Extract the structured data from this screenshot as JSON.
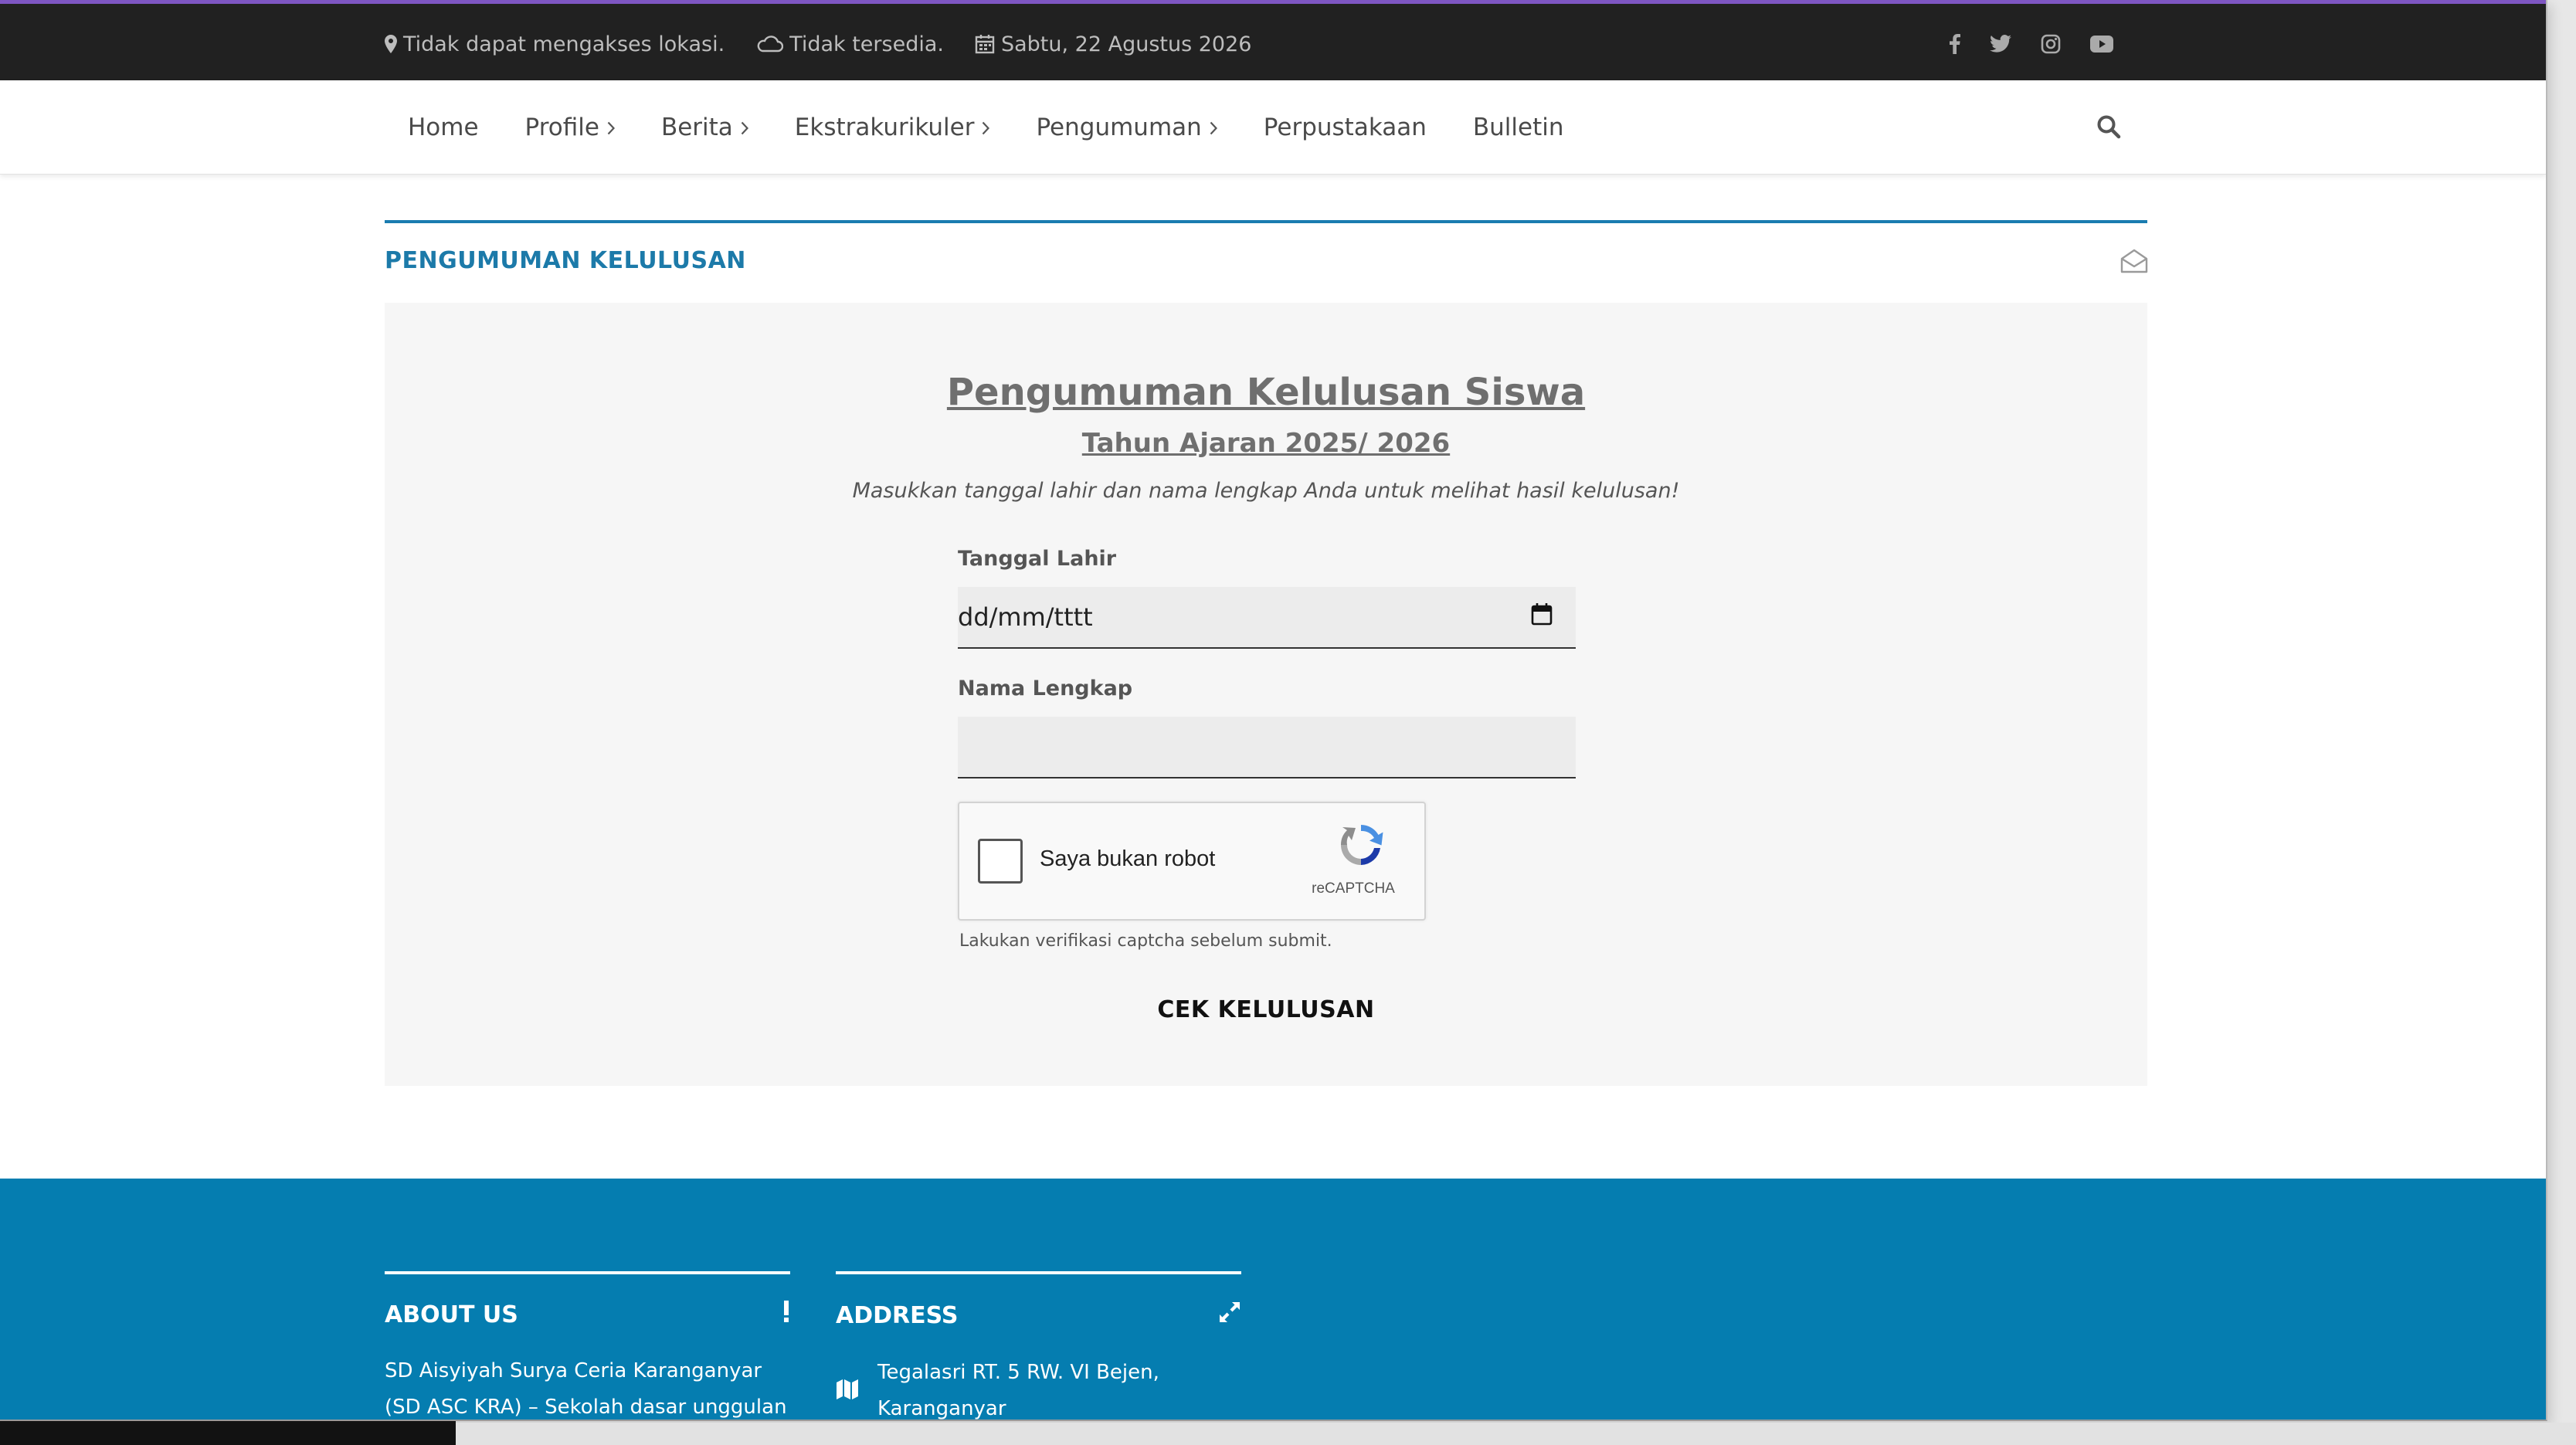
{
  "topbar": {
    "location": "Tidak dapat mengakses lokasi.",
    "weather": "Tidak tersedia.",
    "date": "Sabtu, 22 Agustus 2026",
    "socials": [
      "facebook-icon",
      "twitter-icon",
      "instagram-icon",
      "youtube-icon"
    ]
  },
  "nav": {
    "items": [
      {
        "label": "Home",
        "has_submenu": false
      },
      {
        "label": "Profile",
        "has_submenu": true
      },
      {
        "label": "Berita",
        "has_submenu": true
      },
      {
        "label": "Ekstrakurikuler",
        "has_submenu": true
      },
      {
        "label": "Pengumuman",
        "has_submenu": true
      },
      {
        "label": "Perpustakaan",
        "has_submenu": false
      },
      {
        "label": "Bulletin",
        "has_submenu": false
      }
    ]
  },
  "section": {
    "title": "PENGUMUMAN KELULUSAN"
  },
  "form": {
    "title": "Pengumuman Kelulusan Siswa",
    "subtitle": "Tahun Ajaran 2025/ 2026",
    "instruction": "Masukkan tanggal lahir dan nama lengkap Anda untuk melihat hasil kelulusan!",
    "birthdate_label": "Tanggal Lahir",
    "birthdate_placeholder": "dd/mm/tttt",
    "name_label": "Nama Lengkap",
    "name_value": "",
    "recaptcha_label": "Saya bukan robot",
    "recaptcha_brand": "reCAPTCHA",
    "captcha_note": "Lakukan verifikasi captcha sebelum submit.",
    "submit_label": "CEK KELULUSAN"
  },
  "footer": {
    "about_title": "ABOUT US",
    "about_text": "SD Aisyiyah Surya Ceria Karanganyar (SD ASC KRA) – Sekolah dasar unggulan di",
    "address_title": "ADDRESS",
    "address_text": "Tegalasri RT. 5 RW. VI Bejen, Karanganyar"
  },
  "colors": {
    "topbar_bg": "#212121",
    "accent_purple": "#7e56c2",
    "primary_blue": "#1c7aa9",
    "footer_bg": "#057db0"
  }
}
